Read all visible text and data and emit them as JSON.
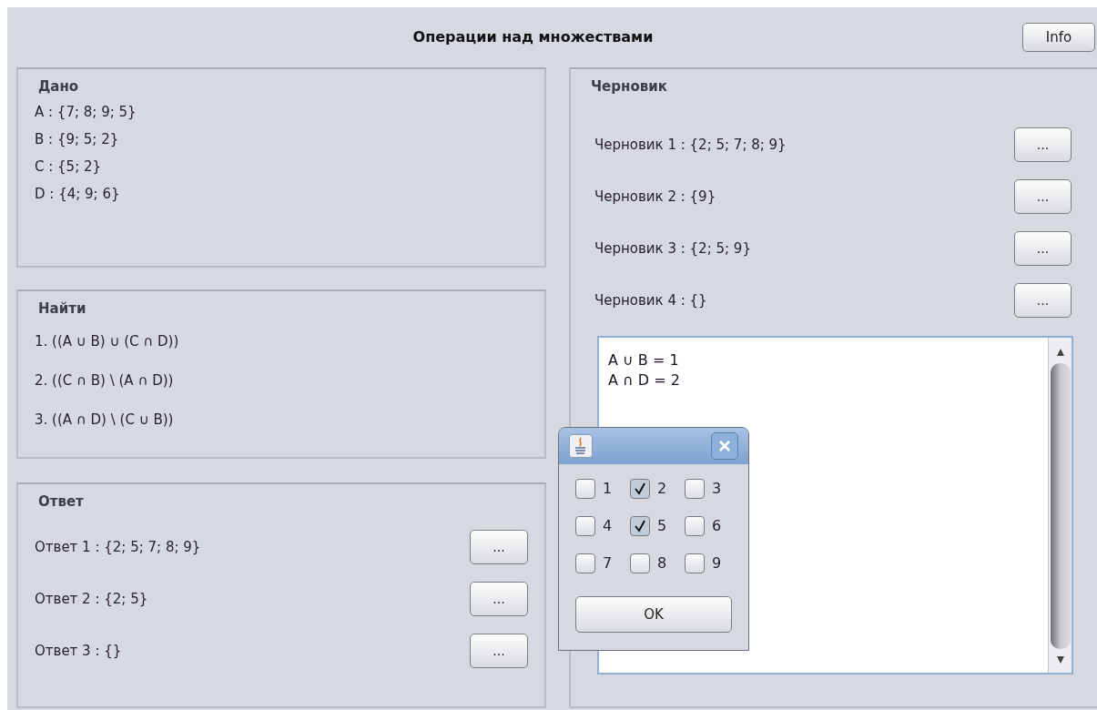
{
  "window": {
    "title": "Операции над множествами",
    "info_button": "Info"
  },
  "given": {
    "title": "Дано",
    "items": [
      "A : {7; 8; 9; 5}",
      "B : {9; 5; 2}",
      "C : {5; 2}",
      "D : {4; 9; 6}"
    ]
  },
  "find": {
    "title": "Найти",
    "items": [
      "1. ((A ∪ B) ∪ (C ∩ D))",
      "2. ((C ∩ B) \\ (A ∩ D))",
      "3. ((A ∩ D) \\ (C ∪ B))"
    ]
  },
  "answer": {
    "title": "Ответ",
    "rows": [
      {
        "label": "Ответ 1 : {2; 5; 7; 8; 9}",
        "button": "..."
      },
      {
        "label": "Ответ 2 : {2; 5}",
        "button": "..."
      },
      {
        "label": "Ответ 3 : {}",
        "button": "..."
      }
    ]
  },
  "draft": {
    "title": "Черновик",
    "rows": [
      {
        "label": "Черновик 1 : {2; 5; 7; 8; 9}",
        "button": "..."
      },
      {
        "label": "Черновик 2 : {9}",
        "button": "..."
      },
      {
        "label": "Черновик 3 : {2; 5; 9}",
        "button": "..."
      },
      {
        "label": "Черновик 4 : {}",
        "button": "..."
      }
    ],
    "notes": [
      "A ∪ B = 1",
      "A ∩ D = 2"
    ]
  },
  "dialog": {
    "checkboxes": [
      {
        "label": "1",
        "checked": false
      },
      {
        "label": "2",
        "checked": true
      },
      {
        "label": "3",
        "checked": false
      },
      {
        "label": "4",
        "checked": false
      },
      {
        "label": "5",
        "checked": true
      },
      {
        "label": "6",
        "checked": false
      },
      {
        "label": "7",
        "checked": false
      },
      {
        "label": "8",
        "checked": false
      },
      {
        "label": "9",
        "checked": false
      }
    ],
    "ok_button": "OK"
  }
}
